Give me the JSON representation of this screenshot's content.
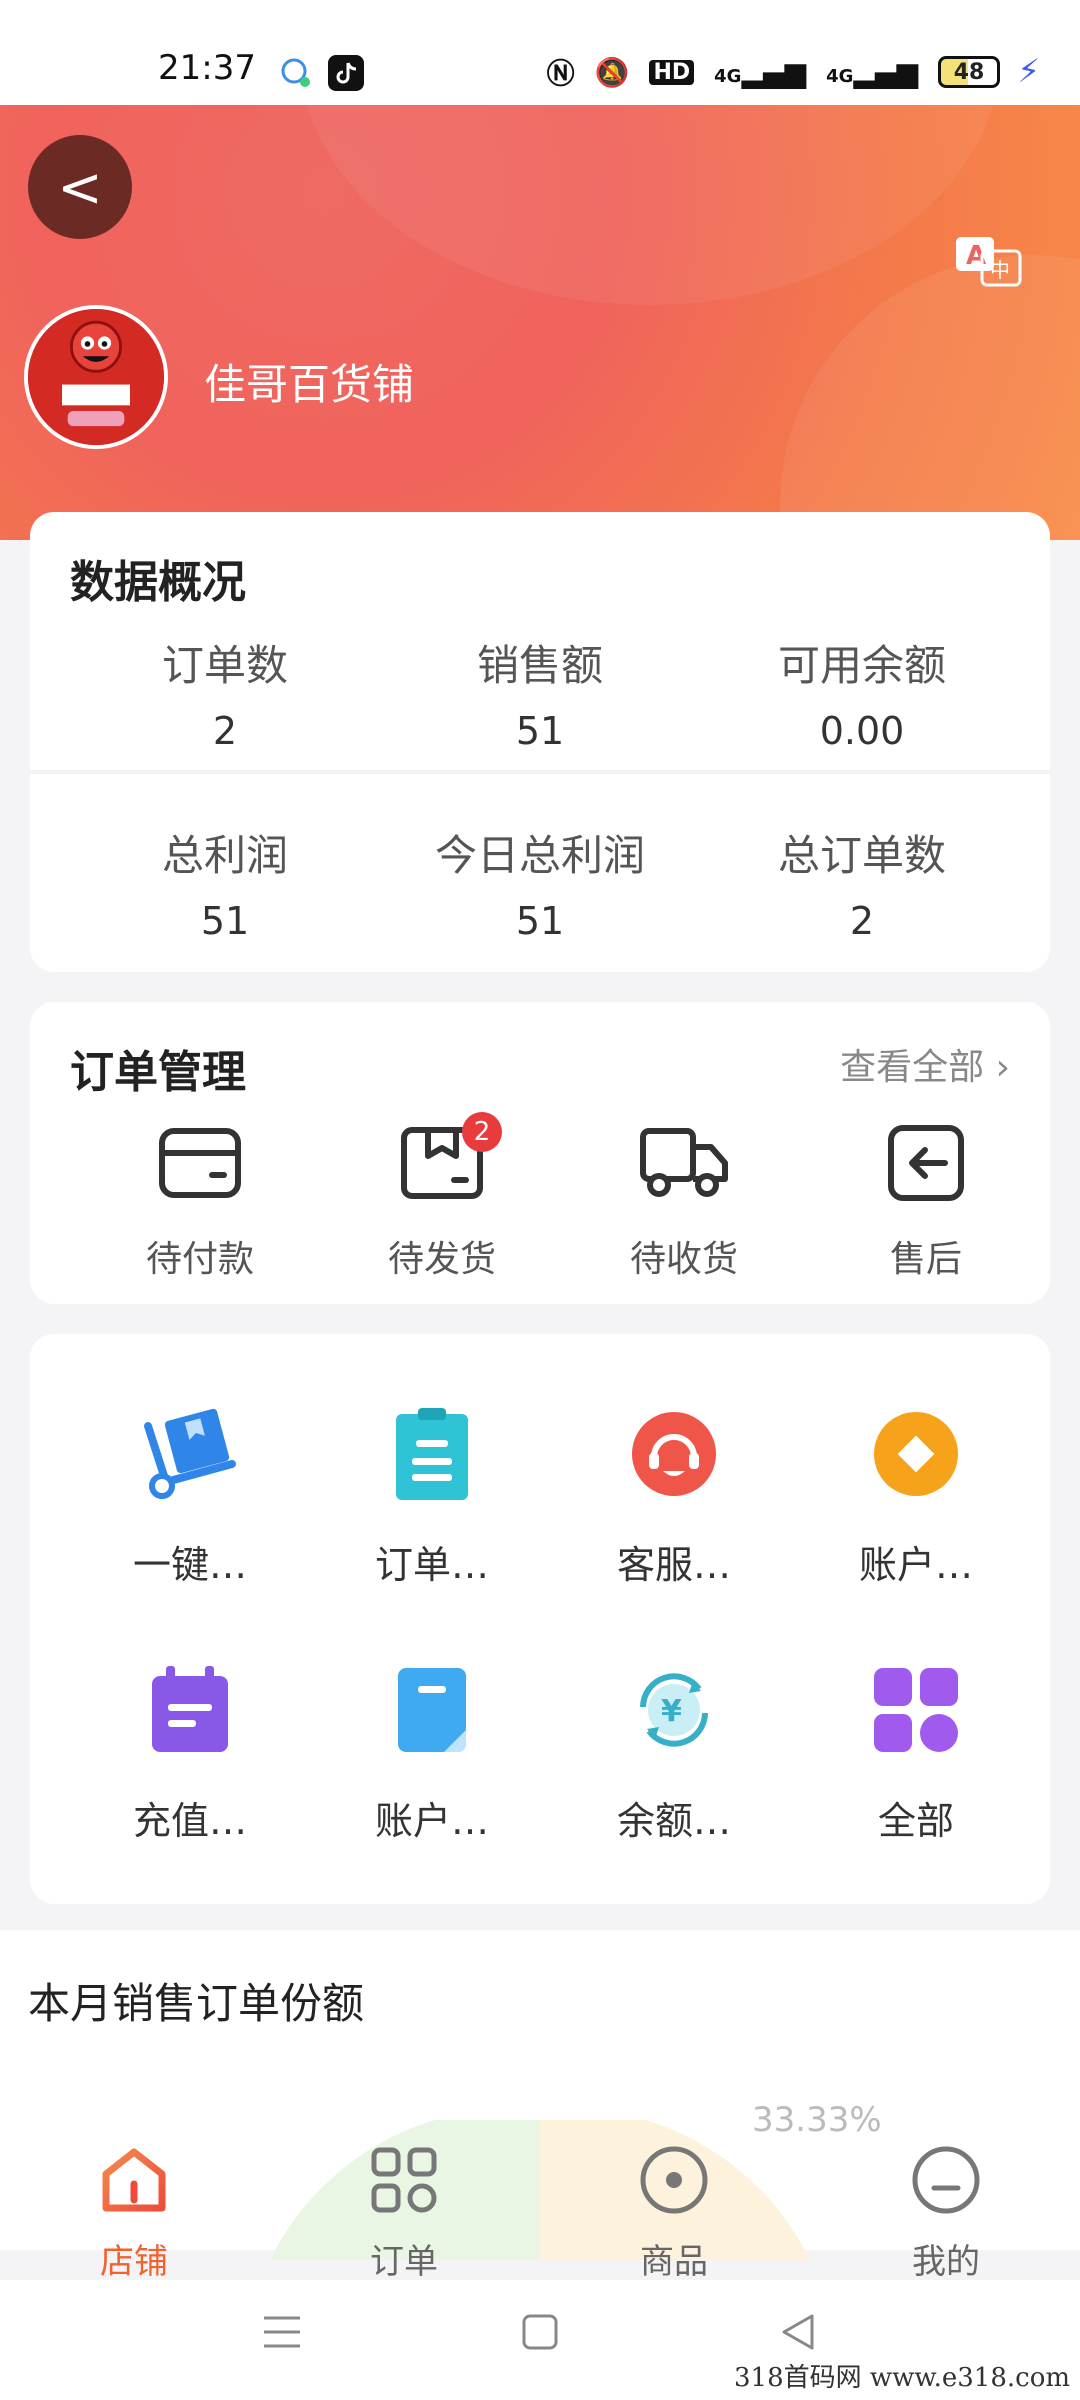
{
  "status_bar": {
    "time": "21:37",
    "battery": "48",
    "net1": "4G",
    "net2": "4G",
    "hd": "HD"
  },
  "header": {
    "back_label": "<",
    "shop_name": "佳哥百货铺"
  },
  "overview": {
    "title": "数据概况",
    "row1": [
      {
        "label": "订单数",
        "value": "2"
      },
      {
        "label": "销售额",
        "value": "51"
      },
      {
        "label": "可用余额",
        "value": "0.00"
      }
    ],
    "row2": [
      {
        "label": "总利润",
        "value": "51"
      },
      {
        "label": "今日总利润",
        "value": "51"
      },
      {
        "label": "总订单数",
        "value": "2"
      }
    ]
  },
  "orders": {
    "title": "订单管理",
    "view_all": "查看全部 ›",
    "items": [
      {
        "label": "待付款",
        "icon": "wallet-icon"
      },
      {
        "label": "待发货",
        "icon": "box-icon",
        "badge": "2"
      },
      {
        "label": "待收货",
        "icon": "truck-icon"
      },
      {
        "label": "售后",
        "icon": "return-icon"
      }
    ]
  },
  "tools": {
    "items": [
      {
        "label": "一键…",
        "icon": "delivery-cart-icon",
        "color": "#2f86e8"
      },
      {
        "label": "订单…",
        "icon": "clipboard-icon",
        "color": "#2ec4d6"
      },
      {
        "label": "客服…",
        "icon": "customer-service-icon",
        "color": "#f0554a"
      },
      {
        "label": "账户…",
        "icon": "diamond-coin-icon",
        "color": "#f7a21b"
      },
      {
        "label": "充值…",
        "icon": "calendar-icon",
        "color": "#8a58e6"
      },
      {
        "label": "账户…",
        "icon": "document-icon",
        "color": "#3fa9f2"
      },
      {
        "label": "余额…",
        "icon": "yuan-refresh-icon",
        "color": "#36b0c9"
      },
      {
        "label": "全部",
        "icon": "grid-all-icon",
        "color": "#a05bee"
      }
    ]
  },
  "sales": {
    "title": "本月销售订单份额",
    "pct": "33.33%"
  },
  "bottom_nav": {
    "items": [
      {
        "label": "店铺",
        "icon": "home-icon",
        "active": true
      },
      {
        "label": "订单",
        "icon": "orders-grid-icon"
      },
      {
        "label": "商品",
        "icon": "goods-icon"
      },
      {
        "label": "我的",
        "icon": "profile-icon"
      }
    ]
  },
  "watermark": "318首码网 www.e318.com",
  "colors": {
    "accent": "#f0622e",
    "header_start": "#ef6a63",
    "header_end": "#f98b48"
  }
}
